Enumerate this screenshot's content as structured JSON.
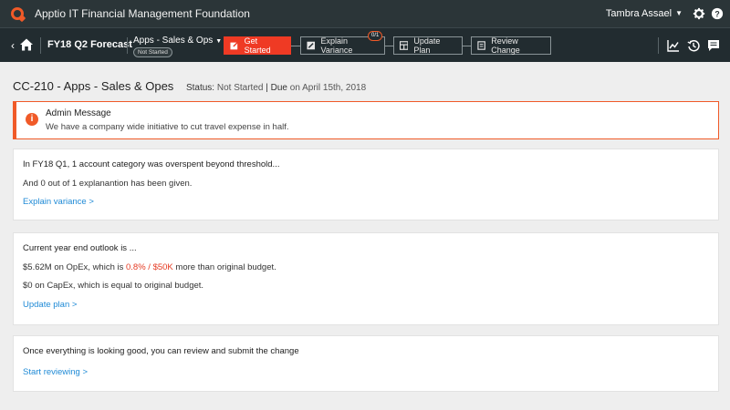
{
  "app": {
    "title": "Apptio IT Financial Management Foundation"
  },
  "user": {
    "name": "Tambra Assael"
  },
  "nav": {
    "forecast": "FY18 Q2 Forecast",
    "scope": {
      "label": "Apps - Sales & Ops",
      "status": "Not Started"
    },
    "steps": [
      {
        "label": "Get Started",
        "active": true,
        "icon": "edit-icon"
      },
      {
        "label": "Explain Variance",
        "active": false,
        "icon": "pencil-icon",
        "counter": "0/1"
      },
      {
        "label": "Update Plan",
        "active": false,
        "icon": "table-icon"
      },
      {
        "label": "Review Change",
        "active": false,
        "icon": "document-icon"
      }
    ]
  },
  "page": {
    "title": "CC-210 - Apps - Sales & Opes",
    "status_label": "Status:",
    "status_value": "Not Started",
    "due_sep": "|",
    "due_label": "Due",
    "due_on": "on",
    "due_value": "April 15th, 2018"
  },
  "admin": {
    "title": "Admin Message",
    "message": "We have a company wide initiative to cut travel expense in half."
  },
  "cards": {
    "variance": {
      "heading": "In FY18 Q1, 1 account category was overspent beyond threshold...",
      "text": "And 0 out of 1 explanantion has been given.",
      "link": "Explain variance >"
    },
    "outlook": {
      "heading": "Current year end outlook is ...",
      "opex_pre": "$5.62M on OpEx, which is ",
      "opex_hl": "0.8% / $50K",
      "opex_post": " more than original budget.",
      "capex": "$0 on CapEx, which is equal to original budget.",
      "link": "Update plan >"
    },
    "review": {
      "heading": "Once everything is looking good, you can review and submit the change",
      "link": "Start reviewing >"
    }
  },
  "colors": {
    "accent": "#ef3a24",
    "link": "#1f8ad6",
    "topbar": "#2b3538"
  }
}
